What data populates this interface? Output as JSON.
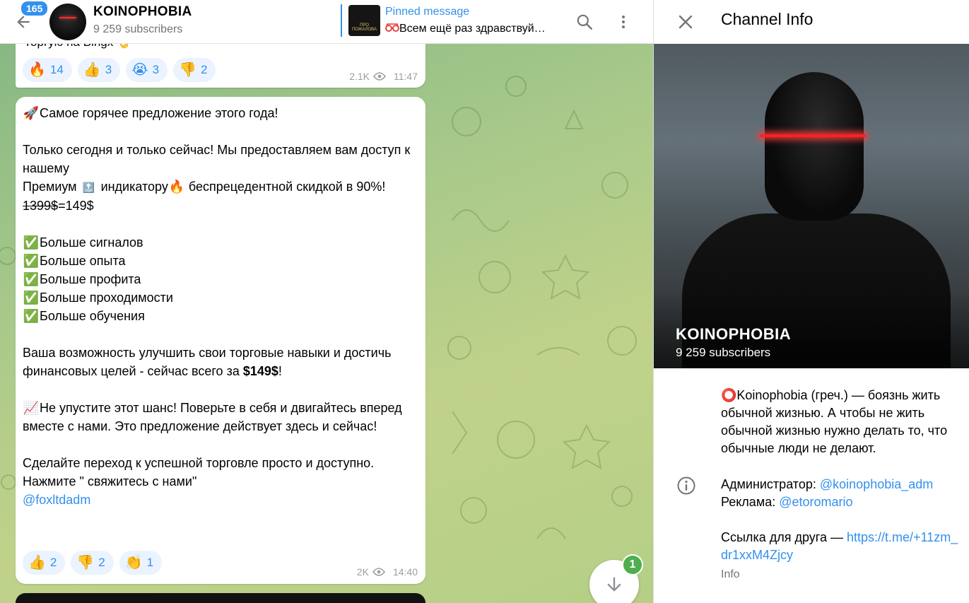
{
  "header": {
    "unread": "165",
    "title": "KOINOPHOBIA",
    "subscribers": "9 259 subscribers",
    "pinned_title": "Pinned message",
    "pinned_text": "Всем ещё раз здравствуй…",
    "pinned_thumb_text": "ПРО ПОЖАЛОВА"
  },
  "messages": [
    {
      "clip_text": "Торгую на Bingx 👌",
      "reactions": [
        {
          "emoji": "🔥",
          "count": "14"
        },
        {
          "emoji": "👍",
          "count": "3"
        },
        {
          "emoji": "😭",
          "count": "3"
        },
        {
          "emoji": "👎",
          "count": "2"
        }
      ],
      "views": "2.1K",
      "time": "11:47"
    },
    {
      "line1": "Самое горячее предложение этого года!",
      "line2": "Только сегодня и только сейчас! Мы предоставляем вам доступ к нашему",
      "line3a": "Премиум ",
      "line3b": " индикатору",
      "line3c": " беспрецедентной скидкой в 90%!",
      "price_old": "1399$",
      "price_new": "=149$",
      "bullets": [
        "Больше сигналов",
        "Больше опыта",
        "Больше профита",
        "Больше проходимости",
        "Больше обучения"
      ],
      "para1a": "Ваша возможность улучшить свои торговые навыки и достичь финансовых целей - сейчас всего за ",
      "para1b": "$149$",
      "para1c": "!",
      "para2": "Не упустите этот шанс! Поверьте в себя и двигайтесь вперед вместе с нами. Это предложение действует здесь и сейчас!",
      "para3": "Сделайте переход к успешной торговле просто и доступно. Нажмите \" свяжитесь с нами\"",
      "contact": "@foxltdadm",
      "reactions": [
        {
          "emoji": "👍",
          "count": "2"
        },
        {
          "emoji": "👎",
          "count": "2"
        },
        {
          "emoji": "👏",
          "count": "1"
        }
      ],
      "views": "2K",
      "time": "14:40"
    }
  ],
  "scroll_badge": "1",
  "panel": {
    "title": "Channel Info",
    "cover_title": "KOINOPHOBIA",
    "cover_subs": "9 259 subscribers",
    "description": "⭕Koinophobia (греч.) — боязнь жить обычной жизнью. А чтобы не жить обычной жизнью нужно делать то, что обычные люди не делают.",
    "admin_label": "Администратор: ",
    "admin_link": "@koinophobia_adm",
    "ads_label": "Реклама: ",
    "ads_link": "@etoromario",
    "friend_label": "Ссылка для друга — ",
    "friend_link": "https://t.me/+11zm_dr1xxM4Zjcy",
    "info_label": "Info"
  }
}
